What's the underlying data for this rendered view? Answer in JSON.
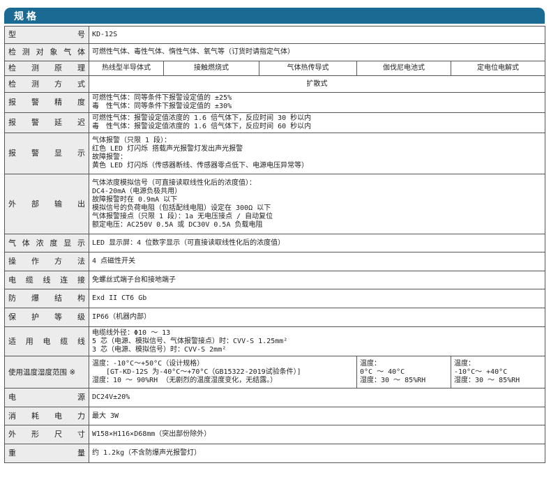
{
  "section_title": "规格",
  "rows": {
    "model": {
      "label": "型号",
      "value": "KD-12S"
    },
    "target": {
      "label": "检测对象气体",
      "value": "可燃性气体、毒性气体、惰性气体、氧气等（订货时请指定气体）"
    },
    "principle": {
      "label": "检测原理",
      "values": [
        "热线型半导体式",
        "接触燃烧式",
        "气体热传导式",
        "伽伐尼电池式",
        "定电位电解式"
      ]
    },
    "method": {
      "label": "检测方式",
      "value": "扩散式"
    },
    "accuracy": {
      "label": "报警精度",
      "lines": [
        "可燃性气体：同等条件下报警设定值的 ±25%",
        "毒　性气体：同等条件下报警设定值的 ±30%"
      ]
    },
    "delay": {
      "label": "报警延迟",
      "lines": [
        "可燃性气体：报警设定值浓度的 1.6 倍气体下，反应时间 30 秒以内",
        "毒　性气体：报警设定值浓度的 1.6 倍气体下，反应时间 60 秒以内"
      ]
    },
    "display": {
      "label": "报警显示",
      "lines": [
        "气体报警（只限 1 段）：",
        "红色 LED 灯闪烁 搭载声光报警灯发出声光报警",
        "故障报警：",
        "黄色 LED 灯闪烁（传感器断线、传感器零点低下、电源电压异常等）"
      ]
    },
    "output": {
      "label": "外部输出",
      "lines": [
        "气体浓度模拟信号（可直接读取线性化后的浓度值）：",
        "DC4-20mA（电源负极共用）",
        "故障报警时在 0.9mA 以下",
        "模拟信号的负荷电阻（包括配线电阻）设定在 300Ω 以下",
        "气体报警接点（只限 1 段）：1a 无电压接点 / 自动复位",
        "额定电压：AC250V 0.5A 或 DC30V 0.5A 负载电阻"
      ]
    },
    "conc_display": {
      "label": "气体浓度显示",
      "value": "LED 显示屏：4 位数字显示（可直接读取线性化后的浓度值）"
    },
    "operation": {
      "label": "操作方法",
      "value": "4 点磁性开关"
    },
    "cable_conn": {
      "label": "电缆线连接",
      "value": "免螺丝式端子台和接地端子"
    },
    "explosion": {
      "label": "防爆结构",
      "value": "Exd II CT6 Gb"
    },
    "protection": {
      "label": "保护等级",
      "value": "IP66（机器内部）"
    },
    "cable": {
      "label": "适用电缆线",
      "lines": [
        "电缆线外径：Φ10 ～ 13",
        "5 芯（电源、模拟信号、气体报警接点）时：CVV-S 1.25mm²",
        "3 芯（电源、模拟信号）时：CVV-S 2mm²"
      ]
    },
    "env": {
      "label": "使用温度湿度范围 ※",
      "col1": [
        "温度：-10°C～+50°C（设计规格）",
        "　　[GT-KD-12S 为-40°C～+70°C（GB15322-2019试验条件）]",
        "湿度：10 ～ 90%RH （无剧烈的温度湿度变化，无结露。）"
      ],
      "col2": [
        "温度：",
        "0°C ～ 40°C",
        "湿度：30 ～ 85%RH"
      ],
      "col3": [
        "温度：",
        "-10°C～ +40°C",
        "湿度：30 ～ 85%RH"
      ]
    },
    "power": {
      "label": "电源",
      "value": "DC24V±20%"
    },
    "consumption": {
      "label": "消耗电力",
      "value": "最大 3W"
    },
    "dimensions": {
      "label": "外形尺寸",
      "value": "W158×H116×D68mm（突出部份除外）"
    },
    "weight": {
      "label": "重量",
      "value": "约 1.2kg（不含防爆声光报警灯）"
    }
  },
  "colors": {
    "banner": "#1b6a93",
    "label_bg": "#ececec",
    "border": "#555555"
  }
}
